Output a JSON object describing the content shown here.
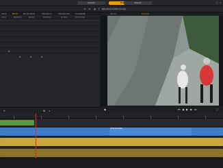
{
  "modes": {
    "import": "Import",
    "edit": "Edit",
    "export": "Export"
  },
  "library": {
    "tabs": [
      "Scene",
      "Effects",
      "Pan and Zoom",
      "Transition In",
      "Transition Out",
      "Time Remap"
    ],
    "active_tab": "Effects",
    "subtabs": [
      "Colors",
      "Keyframes",
      "Motions",
      "Transitions",
      "All Video",
      "Ins and Outs"
    ]
  },
  "preview": {
    "title": "New Movie 12345.mov.axp",
    "tabs": [
      "Source",
      "Timeline"
    ],
    "active_tab": "Timeline"
  },
  "timeline": {
    "clip_label": "00:00:00:00 BRL"
  },
  "colors": {
    "accent": "#f39c12",
    "playhead": "#e02a2a",
    "video_clip": "#3d7cc9",
    "audio_clip": "#c9a73d",
    "title_clip": "#5a9a3a"
  }
}
